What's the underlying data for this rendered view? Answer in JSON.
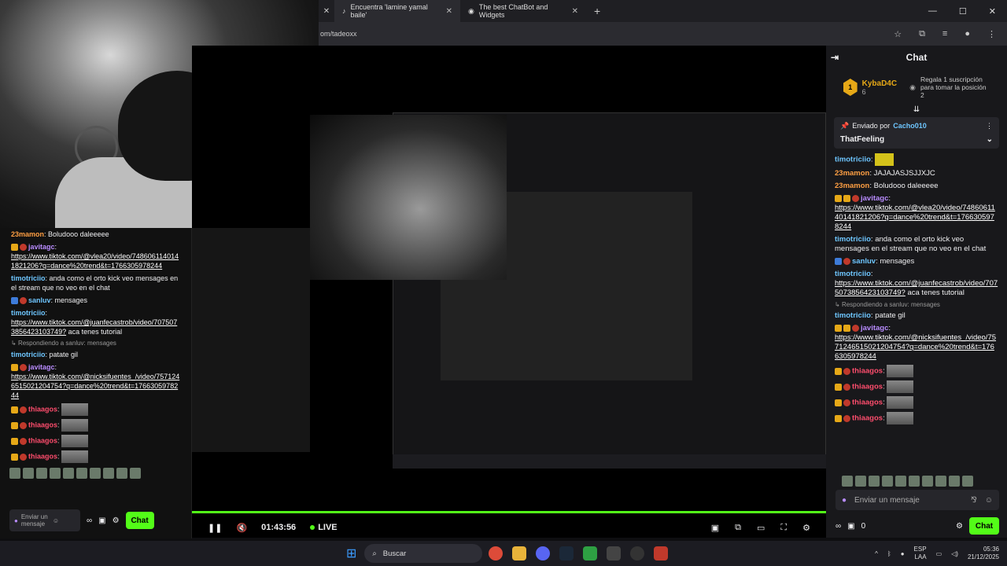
{
  "browser": {
    "tabs": [
      {
        "label": "Encuentra 'lamine yamal baile'",
        "active": true
      },
      {
        "label": "The best ChatBot and Widgets",
        "active": false
      }
    ],
    "url": "om/tadeoxx"
  },
  "left_chat": {
    "messages": [
      {
        "user": "23mamon",
        "text": "Boludooo daleeeee"
      },
      {
        "user": "javitagc",
        "text": "https://www.tiktok.com/@vlea20/video/7486061140141821206?q=dance%20trend&t=1766305978244"
      },
      {
        "user": "timotriciio",
        "text": "anda como el orto kick veo mensages en el stream que no veo en el chat"
      },
      {
        "user": "sanluv",
        "text": "mensages"
      },
      {
        "user": "timotriciio",
        "text": "https://www.tiktok.com/@juanfecastrob/video/7075073856423103749?",
        "text2": "aca tenes tutorial"
      },
      {
        "reply": "Respondiendo a sanluv: mensages"
      },
      {
        "user": "timotriciio",
        "text": "patate gil"
      },
      {
        "user": "javitagc",
        "text": "https://www.tiktok.com/@nicksifuentes_/video/7571246515021204754?q=dance%20trend&t=1766305978244"
      }
    ],
    "thiaagos": [
      "thiaagos",
      "thiaagos",
      "thiaagos",
      "thiaagos"
    ],
    "input_placeholder": "Enviar un mensaje",
    "chat_button": "Chat"
  },
  "video": {
    "time": "01:43:56",
    "live": "LIVE"
  },
  "right_chat": {
    "header": "Chat",
    "top_sub": {
      "rank": "1",
      "user": "KybaD4C",
      "count": "6",
      "cta": "Regala 1 suscripción para tomar la posición 2"
    },
    "pinned": {
      "by_prefix": "Enviado por",
      "by_user": "Cacho010",
      "title": "ThatFeeling"
    },
    "messages": [
      {
        "user": "timotriciio",
        "text": ""
      },
      {
        "user": "23mamon",
        "text": "JAJAJASJSJJXJC"
      },
      {
        "user": "23mamon",
        "text": "Boludooo daleeeee"
      },
      {
        "user": "javitagc",
        "text": "https://www.tiktok.com/@vlea20/video/7486061140141821206?q=dance%20trend&t=1766305978244"
      },
      {
        "user": "timotriciio",
        "text": "anda como el orto kick veo mensages en el stream que no veo en el chat"
      },
      {
        "user": "sanluv",
        "text": "mensages"
      },
      {
        "user": "timotriciio",
        "text": "https://www.tiktok.com/@juanfecastrob/video/7075073856423103749?",
        "text2": "aca tenes tutorial"
      },
      {
        "reply": "Respondiendo a sanluv: mensages"
      },
      {
        "user": "timotriciio",
        "text": "patate gil"
      },
      {
        "user": "javitagc",
        "text": "https://www.tiktok.com/@nicksifuentes_/video/7571246515021204754?q=dance%20trend&t=1766305978244"
      }
    ],
    "thiaagos": [
      "thiaagos",
      "thiaagos",
      "thiaagos",
      "thiaagos"
    ],
    "input_placeholder": "Enviar un mensaje",
    "points": "0",
    "chat_button": "Chat"
  },
  "taskbar": {
    "search": "Buscar",
    "lang": "ESP",
    "region": "LAA",
    "time": "05:36",
    "date": "21/12/2025"
  }
}
